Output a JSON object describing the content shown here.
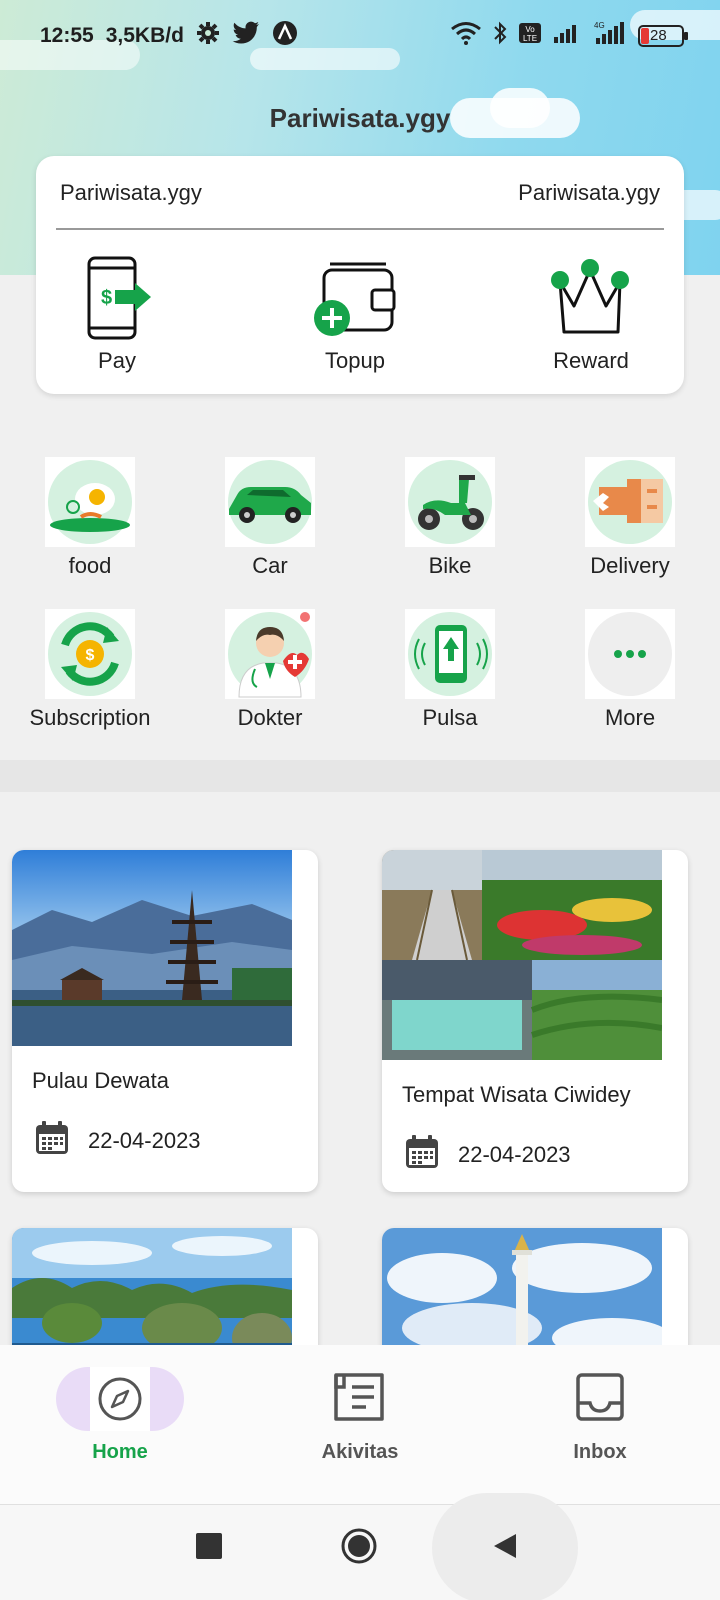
{
  "status_bar": {
    "time": "12:55",
    "speed": "3,5KB/d",
    "battery": "28"
  },
  "app_title": "Pariwisata.ygy",
  "wallet": {
    "left_label": "Pariwisata.ygy",
    "right_label": "Pariwisata.ygy",
    "actions": [
      "Pay",
      "Topup",
      "Reward"
    ]
  },
  "services": [
    {
      "label": "food",
      "icon": "food-icon"
    },
    {
      "label": "Car",
      "icon": "car-icon"
    },
    {
      "label": "Bike",
      "icon": "bike-icon"
    },
    {
      "label": "Delivery",
      "icon": "delivery-icon"
    },
    {
      "label": "Subscription",
      "icon": "subscription-icon"
    },
    {
      "label": "Dokter",
      "icon": "doctor-icon"
    },
    {
      "label": "Pulsa",
      "icon": "phone-credit-icon"
    },
    {
      "label": "More",
      "icon": "more-icon"
    }
  ],
  "trips": [
    {
      "title": "Pulau Dewata",
      "date": "22-04-2023"
    },
    {
      "title": "Tempat Wisata Ciwidey",
      "date": "22-04-2023"
    }
  ],
  "bottom_nav": {
    "items": [
      "Home",
      "Akivitas",
      "Inbox"
    ],
    "active": "Home"
  },
  "colors": {
    "accent": "#16a34a",
    "nav_pill": "#e9dcf7",
    "icon_bg": "#d5f1e0"
  }
}
